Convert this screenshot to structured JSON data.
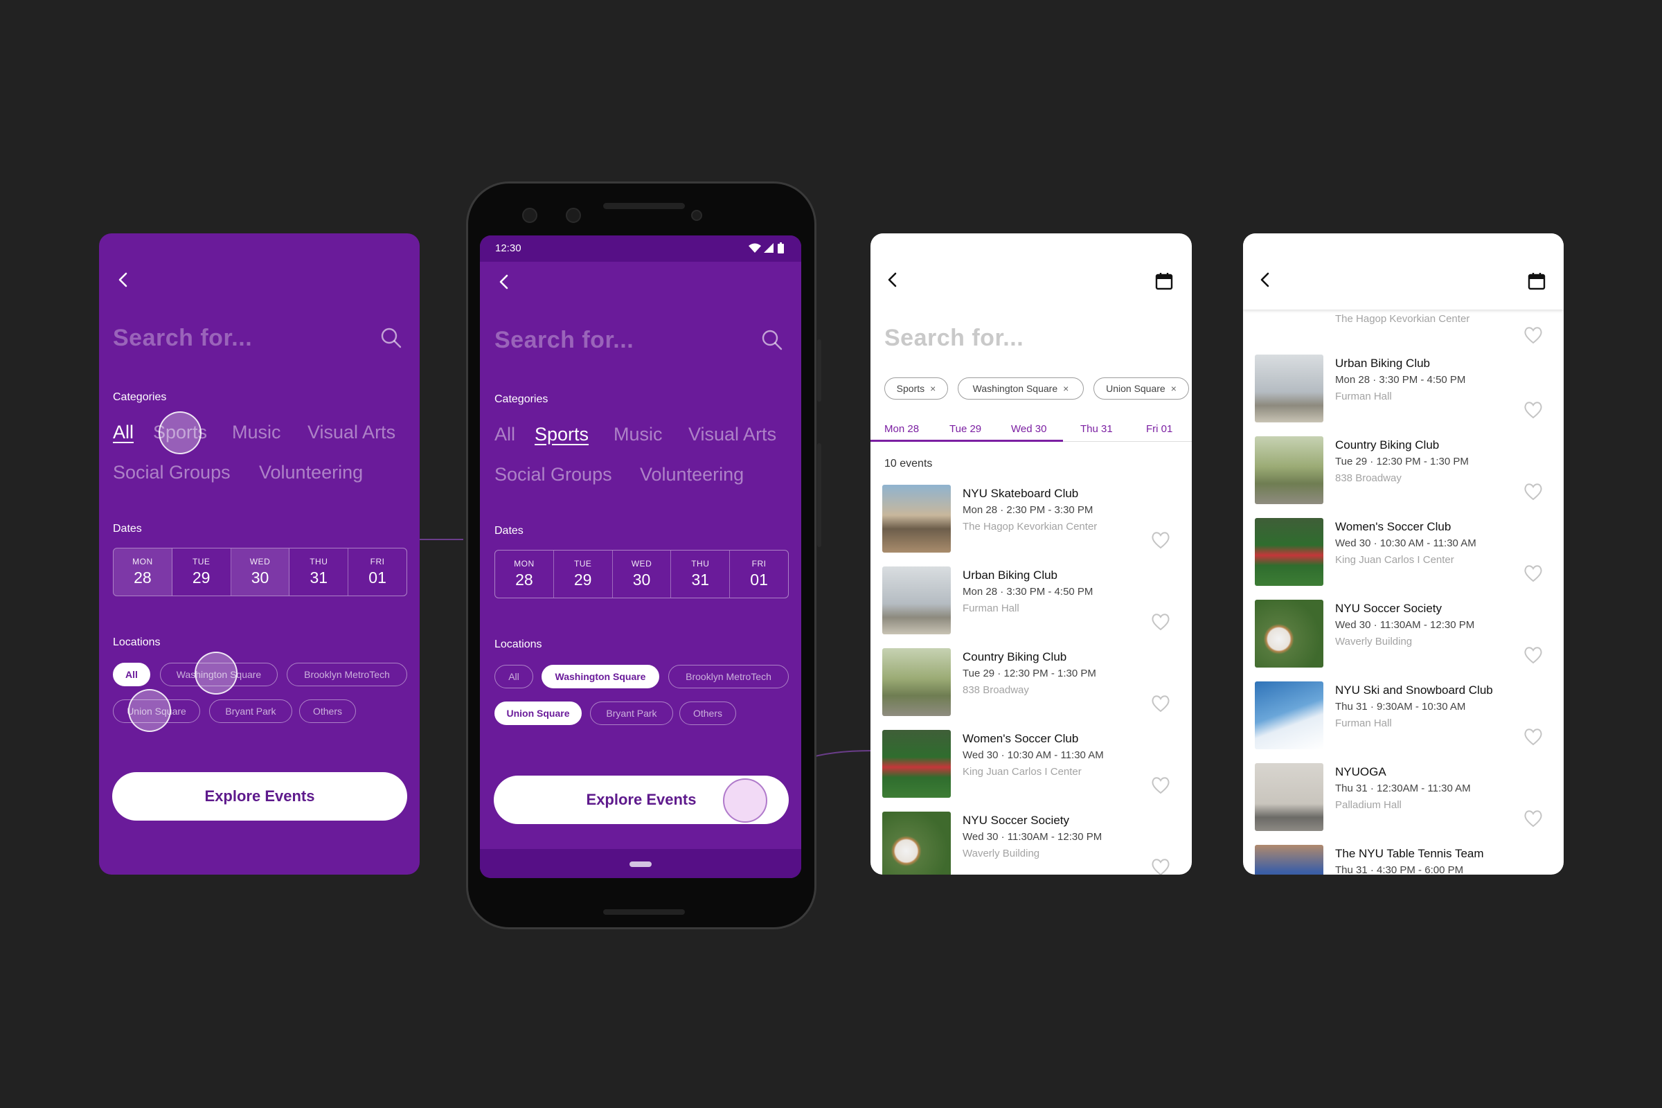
{
  "filter": {
    "back_label": "",
    "search_placeholder": "Search for...",
    "categories_label": "Categories",
    "categories": [
      "All",
      "Sports",
      "Music",
      "Visual Arts",
      "Social Groups",
      "Volunteering"
    ],
    "dates_label": "Dates",
    "dates": [
      {
        "dow": "MON",
        "num": "28"
      },
      {
        "dow": "TUE",
        "num": "29"
      },
      {
        "dow": "WED",
        "num": "30"
      },
      {
        "dow": "THU",
        "num": "31"
      },
      {
        "dow": "FRI",
        "num": "01"
      }
    ],
    "locations_label": "Locations",
    "locations": [
      "All",
      "Washington Square",
      "Brooklyn MetroTech",
      "Union Square",
      "Bryant Park",
      "Others"
    ],
    "explore_label": "Explore Events"
  },
  "screen1_state": {
    "selected_category": "All",
    "selected_dates": [
      "MON",
      "WED"
    ],
    "selected_locations": [
      "All"
    ]
  },
  "screen2_state": {
    "selected_category": "Sports",
    "selected_dates": [],
    "selected_locations": [
      "Washington Square",
      "Union Square"
    ]
  },
  "status_bar": {
    "time": "12:30"
  },
  "results": {
    "search_placeholder": "Search for...",
    "filter_chips": [
      "Sports",
      "Washington Square",
      "Union Square"
    ],
    "chip_remove": "×",
    "date_tabs": [
      "Mon 28",
      "Tue 29",
      "Wed 30",
      "Thu 31",
      "Fri 01"
    ],
    "active_date_tab": "Wed 30",
    "count_label": "10 events"
  },
  "events": [
    {
      "title": "NYU Skateboard Club",
      "time": "Mon 28 · 2:30 PM - 3:30 PM",
      "place": "The Hagop Kevorkian Center"
    },
    {
      "title": "Urban Biking Club",
      "time": "Mon 28 · 3:30 PM - 4:50 PM",
      "place": "Furman Hall"
    },
    {
      "title": "Country Biking Club",
      "time": "Tue 29 · 12:30 PM - 1:30 PM",
      "place": "838 Broadway"
    },
    {
      "title": "Women's Soccer Club",
      "time": "Wed 30 · 10:30 AM - 11:30 AM",
      "place": "King Juan Carlos I Center"
    },
    {
      "title": "NYU Soccer Society",
      "time": "Wed 30 · 11:30AM - 12:30 PM",
      "place": "Waverly Building"
    },
    {
      "title": "NYU Ski and Snowboard Club",
      "time": "Thu 31 · 9:30AM - 10:30 AM",
      "place": "Furman Hall"
    },
    {
      "title": "NYUOGA",
      "time": "Thu 31 · 12:30AM - 11:30 AM",
      "place": "Palladium Hall"
    },
    {
      "title": "The NYU Table Tennis Team",
      "time": "Thu 31 · 4:30 PM - 6:00 PM",
      "place": ""
    }
  ],
  "colors": {
    "purple": "#6A1B9A",
    "purple_dark": "#560F86",
    "accent": "#7B1FA2",
    "background": "#222222"
  }
}
